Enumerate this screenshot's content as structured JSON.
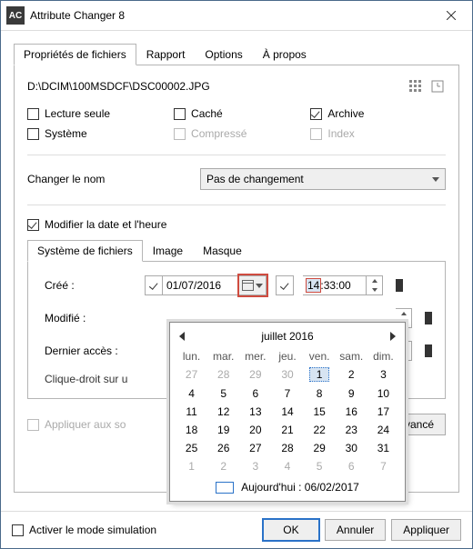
{
  "window": {
    "title": "Attribute Changer 8",
    "icon_label": "AC"
  },
  "tabs": {
    "files": "Propriétés de fichiers",
    "report": "Rapport",
    "options": "Options",
    "about": "À propos"
  },
  "path": "D:\\DCIM\\100MSDCF\\DSC00002.JPG",
  "attrs": {
    "readonly": "Lecture seule",
    "system": "Système",
    "hidden": "Caché",
    "compressed": "Compressé",
    "archive": "Archive",
    "index": "Index"
  },
  "rename": {
    "label": "Changer le nom",
    "value": "Pas de changement"
  },
  "modify_dt": "Modifier la date et l'heure",
  "subtabs": {
    "fs": "Système de fichiers",
    "image": "Image",
    "mask": "Masque"
  },
  "dates": {
    "created_label": "Créé :",
    "modified_label": "Modifié :",
    "accessed_label": "Dernier accès :",
    "created_date": "01/07/2016",
    "created_hour": "14",
    "created_min_sec": ":33:00"
  },
  "hint": "Clique-droit sur u",
  "apply_subfolders": "Appliquer aux so",
  "advanced": "Avancé",
  "simulation": "Activer le mode simulation",
  "buttons": {
    "ok": "OK",
    "cancel": "Annuler",
    "apply": "Appliquer"
  },
  "calendar": {
    "month": "juillet 2016",
    "dow": [
      "lun.",
      "mar.",
      "mer.",
      "jeu.",
      "ven.",
      "sam.",
      "dim."
    ],
    "weeks": [
      [
        {
          "d": 27,
          "o": 1
        },
        {
          "d": 28,
          "o": 1
        },
        {
          "d": 29,
          "o": 1
        },
        {
          "d": 30,
          "o": 1
        },
        {
          "d": 1,
          "sel": 1
        },
        {
          "d": 2
        },
        {
          "d": 3
        }
      ],
      [
        {
          "d": 4
        },
        {
          "d": 5
        },
        {
          "d": 6
        },
        {
          "d": 7
        },
        {
          "d": 8
        },
        {
          "d": 9
        },
        {
          "d": 10
        }
      ],
      [
        {
          "d": 11
        },
        {
          "d": 12
        },
        {
          "d": 13
        },
        {
          "d": 14
        },
        {
          "d": 15
        },
        {
          "d": 16
        },
        {
          "d": 17
        }
      ],
      [
        {
          "d": 18
        },
        {
          "d": 19
        },
        {
          "d": 20
        },
        {
          "d": 21
        },
        {
          "d": 22
        },
        {
          "d": 23
        },
        {
          "d": 24
        }
      ],
      [
        {
          "d": 25
        },
        {
          "d": 26
        },
        {
          "d": 27
        },
        {
          "d": 28
        },
        {
          "d": 29
        },
        {
          "d": 30
        },
        {
          "d": 31
        }
      ],
      [
        {
          "d": 1,
          "o": 1
        },
        {
          "d": 2,
          "o": 1
        },
        {
          "d": 3,
          "o": 1
        },
        {
          "d": 4,
          "o": 1
        },
        {
          "d": 5,
          "o": 1
        },
        {
          "d": 6,
          "o": 1
        },
        {
          "d": 7,
          "o": 1
        }
      ]
    ],
    "today": "Aujourd'hui : 06/02/2017"
  }
}
